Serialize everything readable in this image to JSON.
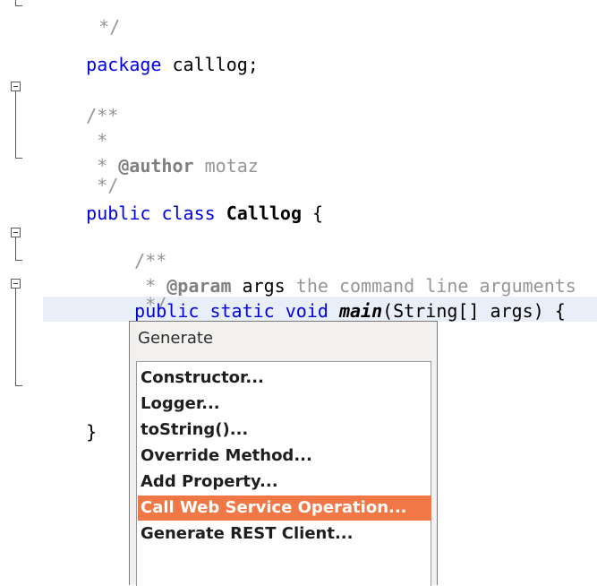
{
  "editor": {
    "lines": {
      "top_comment_end": "*/",
      "package_kw": "package",
      "package_name": " calllog;",
      "doc_open": "/**",
      "doc_star": "*",
      "author_star": "* ",
      "author_tag": "@author",
      "author_name": " motaz",
      "doc_close": "*/",
      "class_public": "public",
      "class_kw": " class ",
      "class_name": "Calllog",
      "class_brace": " {",
      "method_doc_open": "/**",
      "param_star": "* ",
      "param_tag": "@param",
      "param_name": " args",
      "param_desc": " the command line arguments",
      "method_doc_close": "*/",
      "method_mods": "public static void ",
      "method_name": "main",
      "method_sig": "(String[] args) {",
      "method_close": "}",
      "class_close": "}"
    }
  },
  "popup": {
    "title": "Generate",
    "items": [
      {
        "label": "Constructor..."
      },
      {
        "label": "Logger..."
      },
      {
        "label": "toString()..."
      },
      {
        "label": "Override Method..."
      },
      {
        "label": "Add Property..."
      },
      {
        "label": "Call Web Service Operation...",
        "selected": true
      },
      {
        "label": "Generate REST Client..."
      }
    ],
    "selected_color": "#f07746"
  }
}
